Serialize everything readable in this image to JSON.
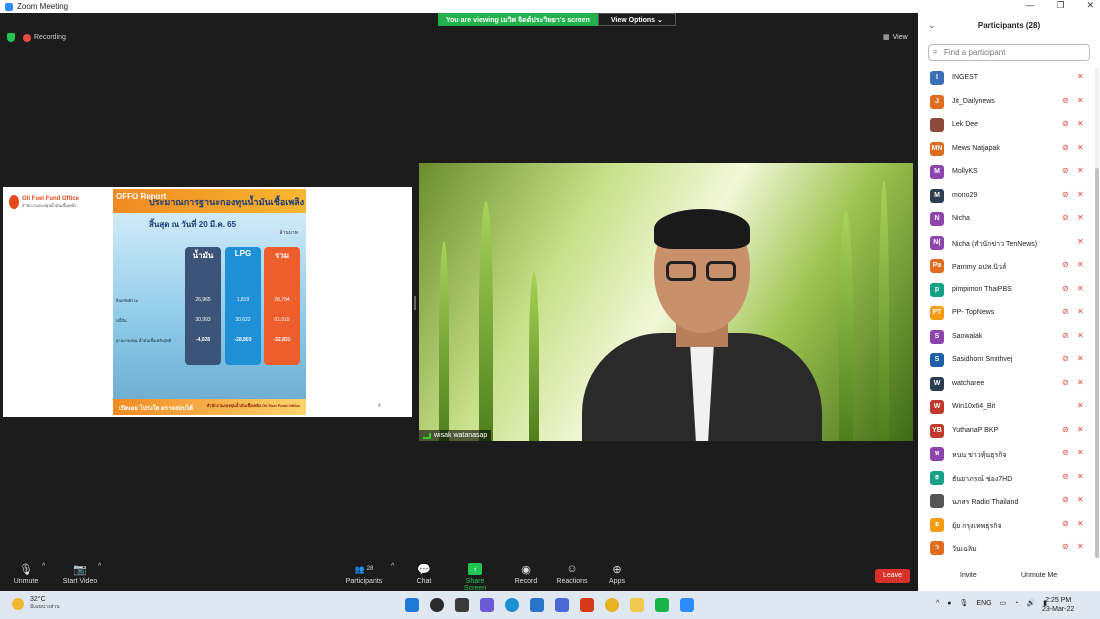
{
  "window": {
    "title": "Zoom Meeting",
    "controls": [
      "—",
      "❐",
      "✕"
    ]
  },
  "banner": {
    "message": "You are viewing เมวิศ จิตต์ประวิทยา's screen",
    "view_options": "View Options ⌄"
  },
  "status": {
    "recording": "Recording",
    "view": "View"
  },
  "slide": {
    "brand_title": "Oil Fuel Fund Office",
    "brand_sub": "สำนักงานกองทุนน้ำมันเชื้อเพลิง",
    "tag": "OFFO Report",
    "title": "ประมาณการฐานะกองทุนน้ำมันเชื้อเพลิง",
    "subtitle": "สิ้นสุด ณ วันที่ 20 มี.ค. 65",
    "unit": "ล้านบาท",
    "row_labels": [
      "สินทรัพย์รวม",
      "หนี้สิน",
      "ฐานะกองทุน น้ำมันเชื้อเพลิงสุทธิ"
    ],
    "columns": [
      {
        "header": "น้ำมัน",
        "values": [
          "26,965",
          "30,993",
          "-4,028"
        ],
        "color": "#3b5477"
      },
      {
        "header": "LPG",
        "values": [
          "1,819",
          "30,622",
          "-28,803"
        ],
        "color": "#1f8fd6"
      },
      {
        "header": "รวม",
        "values": [
          "28,784",
          "61,615",
          "-32,831"
        ],
        "color": "#ee5d2c"
      }
    ],
    "footer_left": "เปิดเผย โปร่งใส ตรวจสอบได้",
    "footer_right": "สำนักงานกองทุนน้ำมันเชื้อเพลิง Oil Fuel Fund Office",
    "page": "4"
  },
  "video": {
    "name": "wisak watanasap"
  },
  "toolbar": {
    "unmute": "Unmute",
    "start_video": "Start Video",
    "participants": "Participants",
    "participants_count": "28",
    "chat": "Chat",
    "share_screen": "Share Screen",
    "record": "Record",
    "reactions": "Reactions",
    "apps": "Apps",
    "leave": "Leave"
  },
  "panel": {
    "title": "Participants (28)",
    "search_placeholder": "Find a participant",
    "invite": "Invite",
    "unmute_me": "Unmute Me",
    "participants": [
      {
        "initial": "I",
        "name": "INGEST",
        "color": "#3b6fb6",
        "video": false
      },
      {
        "initial": "J",
        "name": "Jit_Dailynews",
        "color": "#e06c1f",
        "video": true
      },
      {
        "initial": "",
        "name": "Lek Dee",
        "color": "#8b4a3c",
        "video": true
      },
      {
        "initial": "MN",
        "name": "Mews Natjapak",
        "color": "#e06c1f",
        "video": true
      },
      {
        "initial": "M",
        "name": "MollyKS",
        "color": "#8e44ad",
        "video": true
      },
      {
        "initial": "M",
        "name": "mono29",
        "color": "#2c3e50",
        "video": true
      },
      {
        "initial": "N",
        "name": "Nicha",
        "color": "#8e44ad",
        "video": true
      },
      {
        "initial": "N(",
        "name": "Nicha (สำนักข่าว TenNews)",
        "color": "#8e44ad",
        "video": false
      },
      {
        "initial": "Pa",
        "name": "Parnmy อปท.นิวส์",
        "color": "#e06c1f",
        "video": true
      },
      {
        "initial": "p",
        "name": "pimpimon ThaiPBS",
        "color": "#16a085",
        "video": true
      },
      {
        "initial": "PT",
        "name": "PP- TopNews",
        "color": "#f39c12",
        "video": true
      },
      {
        "initial": "S",
        "name": "Saowalak",
        "color": "#8e44ad",
        "video": true
      },
      {
        "initial": "S",
        "name": "Sasidhorn Smithvej",
        "color": "#1f5fa8",
        "video": true
      },
      {
        "initial": "W",
        "name": "watcharee",
        "color": "#2c3e50",
        "video": true
      },
      {
        "initial": "W",
        "name": "Win10x64_Bit",
        "color": "#c0392b",
        "video": false
      },
      {
        "initial": "YB",
        "name": "YuthanaP BKP",
        "color": "#c0392b",
        "video": true
      },
      {
        "initial": "ห",
        "name": "หนน ข่าวหุ้นธุรกิจ",
        "color": "#8e44ad",
        "video": true
      },
      {
        "initial": "ธ",
        "name": "ธันยาภรณ์ ช่อง7HD",
        "color": "#16a085",
        "video": true
      },
      {
        "initial": "",
        "name": "นภสร Radio Thailand",
        "color": "#555555",
        "video": true
      },
      {
        "initial": "ย",
        "name": "ยุ้ย กรุงเทพธุรกิจ",
        "color": "#f39c12",
        "video": true
      },
      {
        "initial": "ว",
        "name": "วันเฉลิม",
        "color": "#e06c1f",
        "video": true
      }
    ]
  },
  "taskbar": {
    "temp": "32°C",
    "weather": "มีเมฆบางส่วน",
    "lang": "ENG",
    "time": "2:25 PM",
    "date": "23-Mar-22"
  }
}
